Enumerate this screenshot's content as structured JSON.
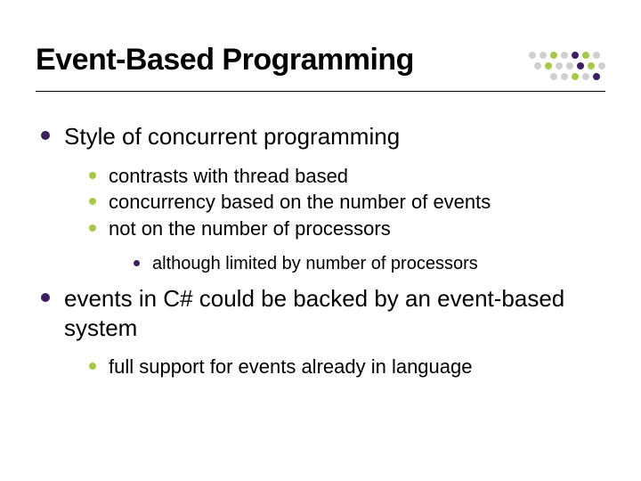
{
  "title": "Event-Based Programming",
  "content": {
    "b1": {
      "text": "Style of concurrent programming",
      "sub": {
        "s0": "contrasts with thread based",
        "s1": "concurrency based on the number of events",
        "s2": "not on the number of processors",
        "s2_sub": {
          "t0": "although limited by number of processors"
        }
      }
    },
    "b2": {
      "text": "events in C# could be backed by an event-based system",
      "sub": {
        "s0": "full support for events already in language"
      }
    }
  },
  "decor": {
    "colors": {
      "purple": "#3d1e5f",
      "green": "#a6c84a",
      "grey": "#cfcfcf"
    }
  }
}
